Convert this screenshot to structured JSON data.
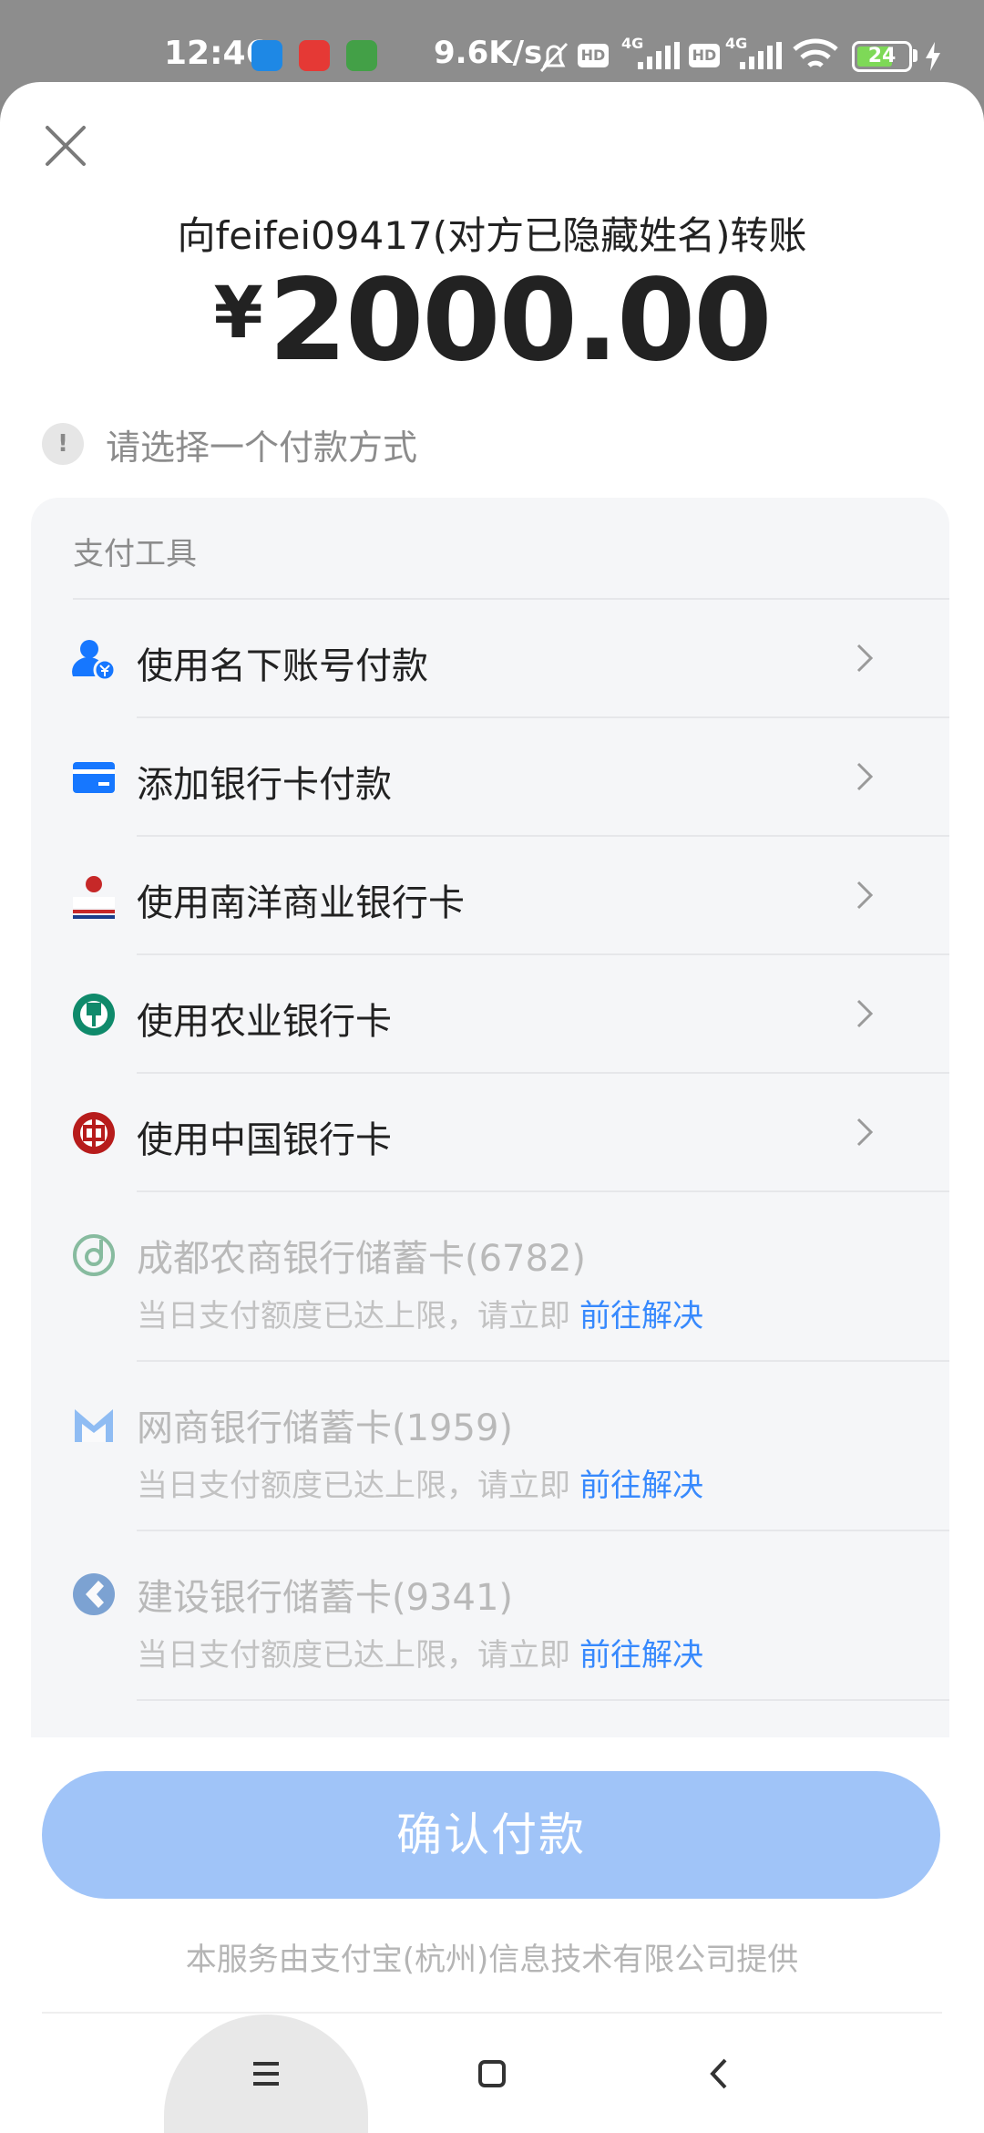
{
  "status_bar": {
    "time": "12:46",
    "network_speed": "9.6K/s",
    "signal_1": "4G",
    "signal_2": "4G",
    "hd_1": "HD",
    "hd_2": "HD",
    "battery": "24"
  },
  "header": {
    "title": "向feifei09417(对方已隐藏姓名)转账",
    "currency": "¥",
    "amount": "2000.00",
    "notice_icon": "!",
    "notice": "请选择一个付款方式"
  },
  "panel": {
    "heading": "支付工具",
    "options": [
      {
        "label": "使用名下账号付款",
        "icon": "user-account-icon"
      },
      {
        "label": "添加银行卡付款",
        "icon": "bank-card-icon"
      },
      {
        "label": "使用南洋商业银行卡",
        "icon": "ncb-bank-icon"
      },
      {
        "label": "使用农业银行卡",
        "icon": "abc-bank-icon"
      },
      {
        "label": "使用中国银行卡",
        "icon": "boc-bank-icon"
      }
    ],
    "disabled_cards": [
      {
        "label": "成都农商银行储蓄卡(6782)",
        "sub": "当日支付额度已达上限，请立即",
        "link": "前往解决",
        "icon": "chengdu-rural-bank-icon"
      },
      {
        "label": "网商银行储蓄卡(1959)",
        "sub": "当日支付额度已达上限，请立即",
        "link": "前往解决",
        "icon": "mybank-icon"
      },
      {
        "label": "建设银行储蓄卡(9341)",
        "sub": "当日支付额度已达上限，请立即",
        "link": "前往解决",
        "icon": "ccb-bank-icon"
      }
    ]
  },
  "confirm_button": "确认付款",
  "footer": "本服务由支付宝(杭州)信息技术有限公司提供",
  "colors": {
    "accent": "#1677ff",
    "confirm_disabled": "#a0c4f8",
    "panel_bg": "#f5f6f8"
  }
}
